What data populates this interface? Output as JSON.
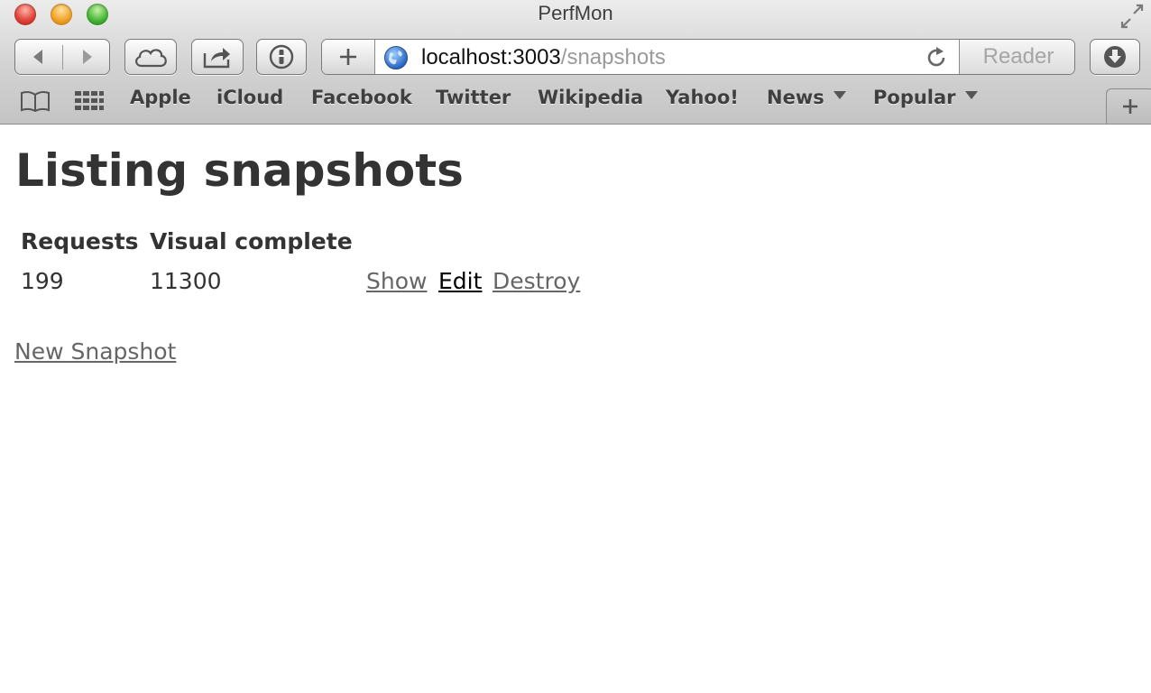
{
  "window": {
    "title": "PerfMon"
  },
  "toolbar": {
    "url_host": "localhost:3003",
    "url_path": "/snapshots",
    "reader_label": "Reader"
  },
  "bookmarks": {
    "items": [
      {
        "label": "Apple",
        "has_menu": false
      },
      {
        "label": "iCloud",
        "has_menu": false
      },
      {
        "label": "Facebook",
        "has_menu": false
      },
      {
        "label": "Twitter",
        "has_menu": false
      },
      {
        "label": "Wikipedia",
        "has_menu": false
      },
      {
        "label": "Yahoo!",
        "has_menu": false
      },
      {
        "label": "News",
        "has_menu": true
      },
      {
        "label": "Popular",
        "has_menu": true
      }
    ]
  },
  "page": {
    "title": "Listing snapshots",
    "table": {
      "headers": [
        "Requests",
        "Visual complete"
      ],
      "rows": [
        {
          "requests": "199",
          "visual_complete": "11300",
          "actions": [
            "Show",
            "Edit",
            "Destroy"
          ]
        }
      ]
    },
    "new_link": "New Snapshot"
  },
  "colors": {
    "text": "#333333",
    "link": "#666666",
    "link_hover": "#000000",
    "url_path": "#9a9a9a"
  }
}
